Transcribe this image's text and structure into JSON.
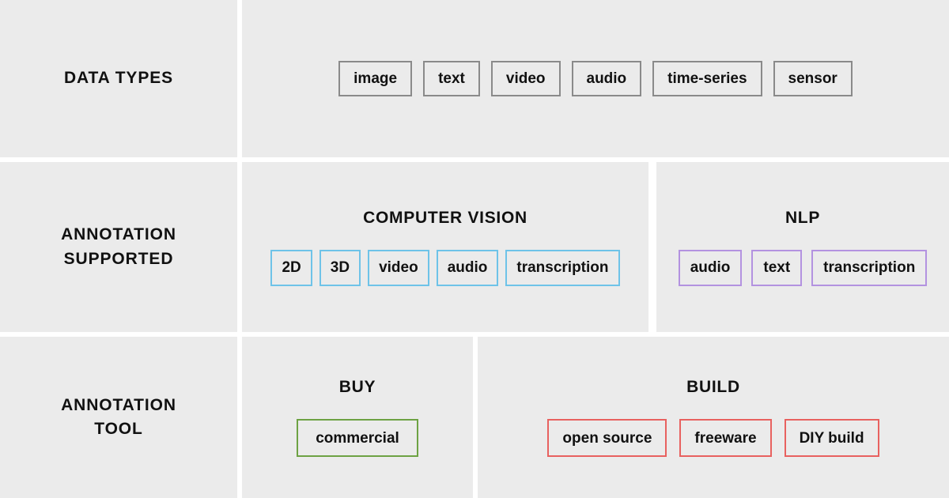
{
  "rows": [
    {
      "label": "DATA TYPES",
      "groups": [
        {
          "title": "",
          "chips": [
            "image",
            "text",
            "video",
            "audio",
            "time-series",
            "sensor"
          ],
          "border_color": "#8a8a8a"
        }
      ]
    },
    {
      "label": "ANNOTATION\nSUPPORTED",
      "label_line1": "ANNOTATION",
      "label_line2": "SUPPORTED",
      "groups": [
        {
          "title": "COMPUTER VISION",
          "chips": [
            "2D",
            "3D",
            "video",
            "audio",
            "transcription"
          ],
          "border_color": "#6ec3e8"
        },
        {
          "title": "NLP",
          "chips": [
            "audio",
            "text",
            "transcription"
          ],
          "border_color": "#b392e0"
        }
      ]
    },
    {
      "label": "ANNOTATION\nTOOL",
      "label_line1": "ANNOTATION",
      "label_line2": "TOOL",
      "groups": [
        {
          "title": "BUY",
          "chips": [
            "commercial"
          ],
          "border_color": "#6da243"
        },
        {
          "title": "BUILD",
          "chips": [
            "open source",
            "freeware",
            "DIY build"
          ],
          "border_color": "#e8615f"
        }
      ]
    }
  ],
  "colors": {
    "page_background": "#ffffff",
    "panel_background": "#ebebeb",
    "text": "#111111",
    "gray_border": "#8a8a8a",
    "blue_border": "#6ec3e8",
    "purple_border": "#b392e0",
    "green_border": "#6da243",
    "red_border": "#e8615f"
  }
}
